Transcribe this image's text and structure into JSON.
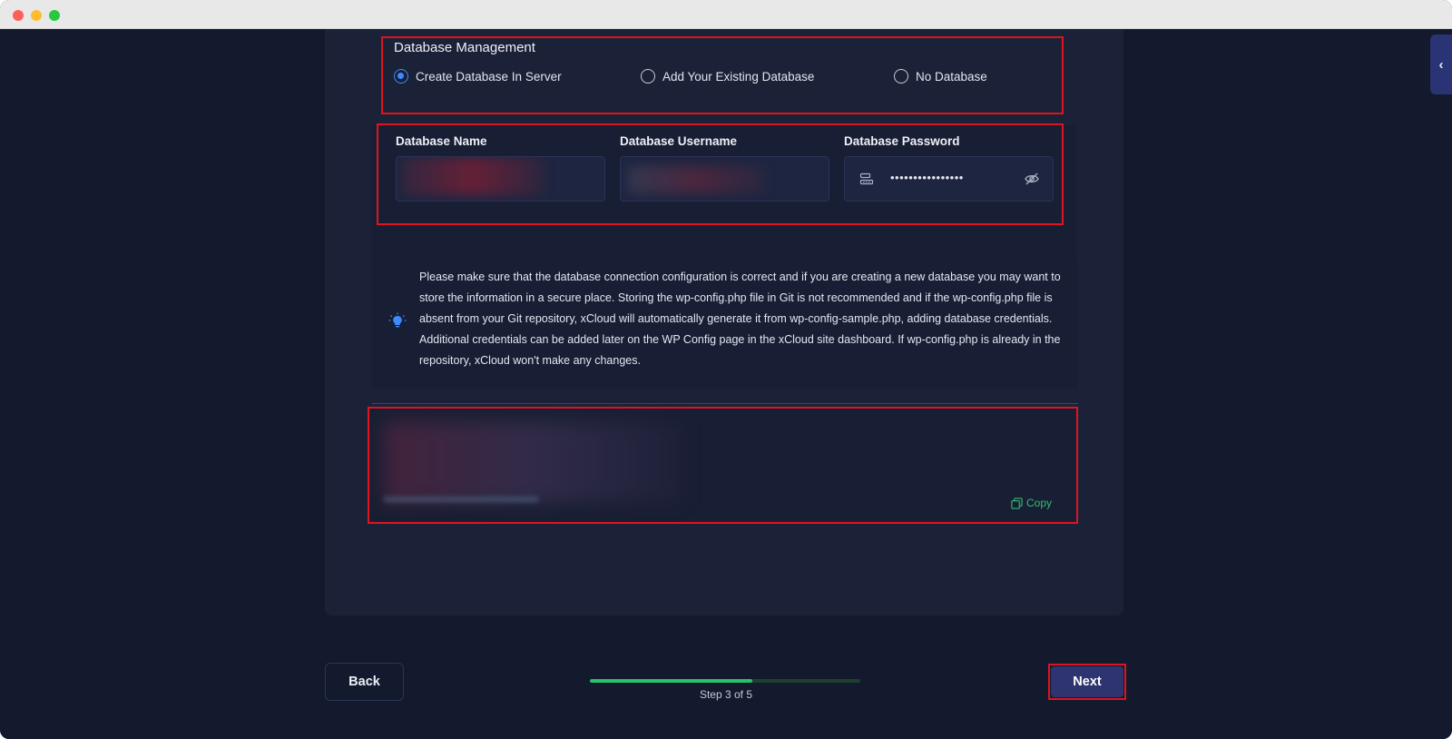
{
  "window": {
    "controls": [
      "close",
      "minimize",
      "zoom"
    ]
  },
  "database_management": {
    "title": "Database Management",
    "options": [
      {
        "label": "Create Database In Server",
        "selected": true
      },
      {
        "label": "Add Your Existing Database",
        "selected": false
      },
      {
        "label": "No Database",
        "selected": false
      }
    ]
  },
  "fields": {
    "name_label": "Database Name",
    "username_label": "Database Username",
    "password_label": "Database Password",
    "password_value": "••••••••••••••••"
  },
  "notice": {
    "icon": "bulb-icon",
    "text": "Please make sure that the database connection configuration is correct and if you are creating a new database you may want to store the information in a secure place. Storing the wp-config.php file in Git is not recommended and if the wp-config.php file is absent from your Git repository, xCloud will automatically generate it from wp-config-sample.php, adding database credentials. Additional credentials can be added later on the WP Config page in the xCloud site dashboard. If wp-config.php is already in the repository, xCloud won't make any changes."
  },
  "code_box": {
    "copy_label": "Copy"
  },
  "footer": {
    "back_label": "Back",
    "next_label": "Next",
    "step_text": "Step 3 of 5",
    "progress": 0.6
  },
  "colors": {
    "background": "#141a2e",
    "panel": "#1b2137",
    "accent_blue": "#3d8bfd",
    "progress_green": "#27c26b",
    "copy_green": "#2fbf71",
    "next_button": "#2e3470",
    "highlight_red": "#e0141e"
  }
}
